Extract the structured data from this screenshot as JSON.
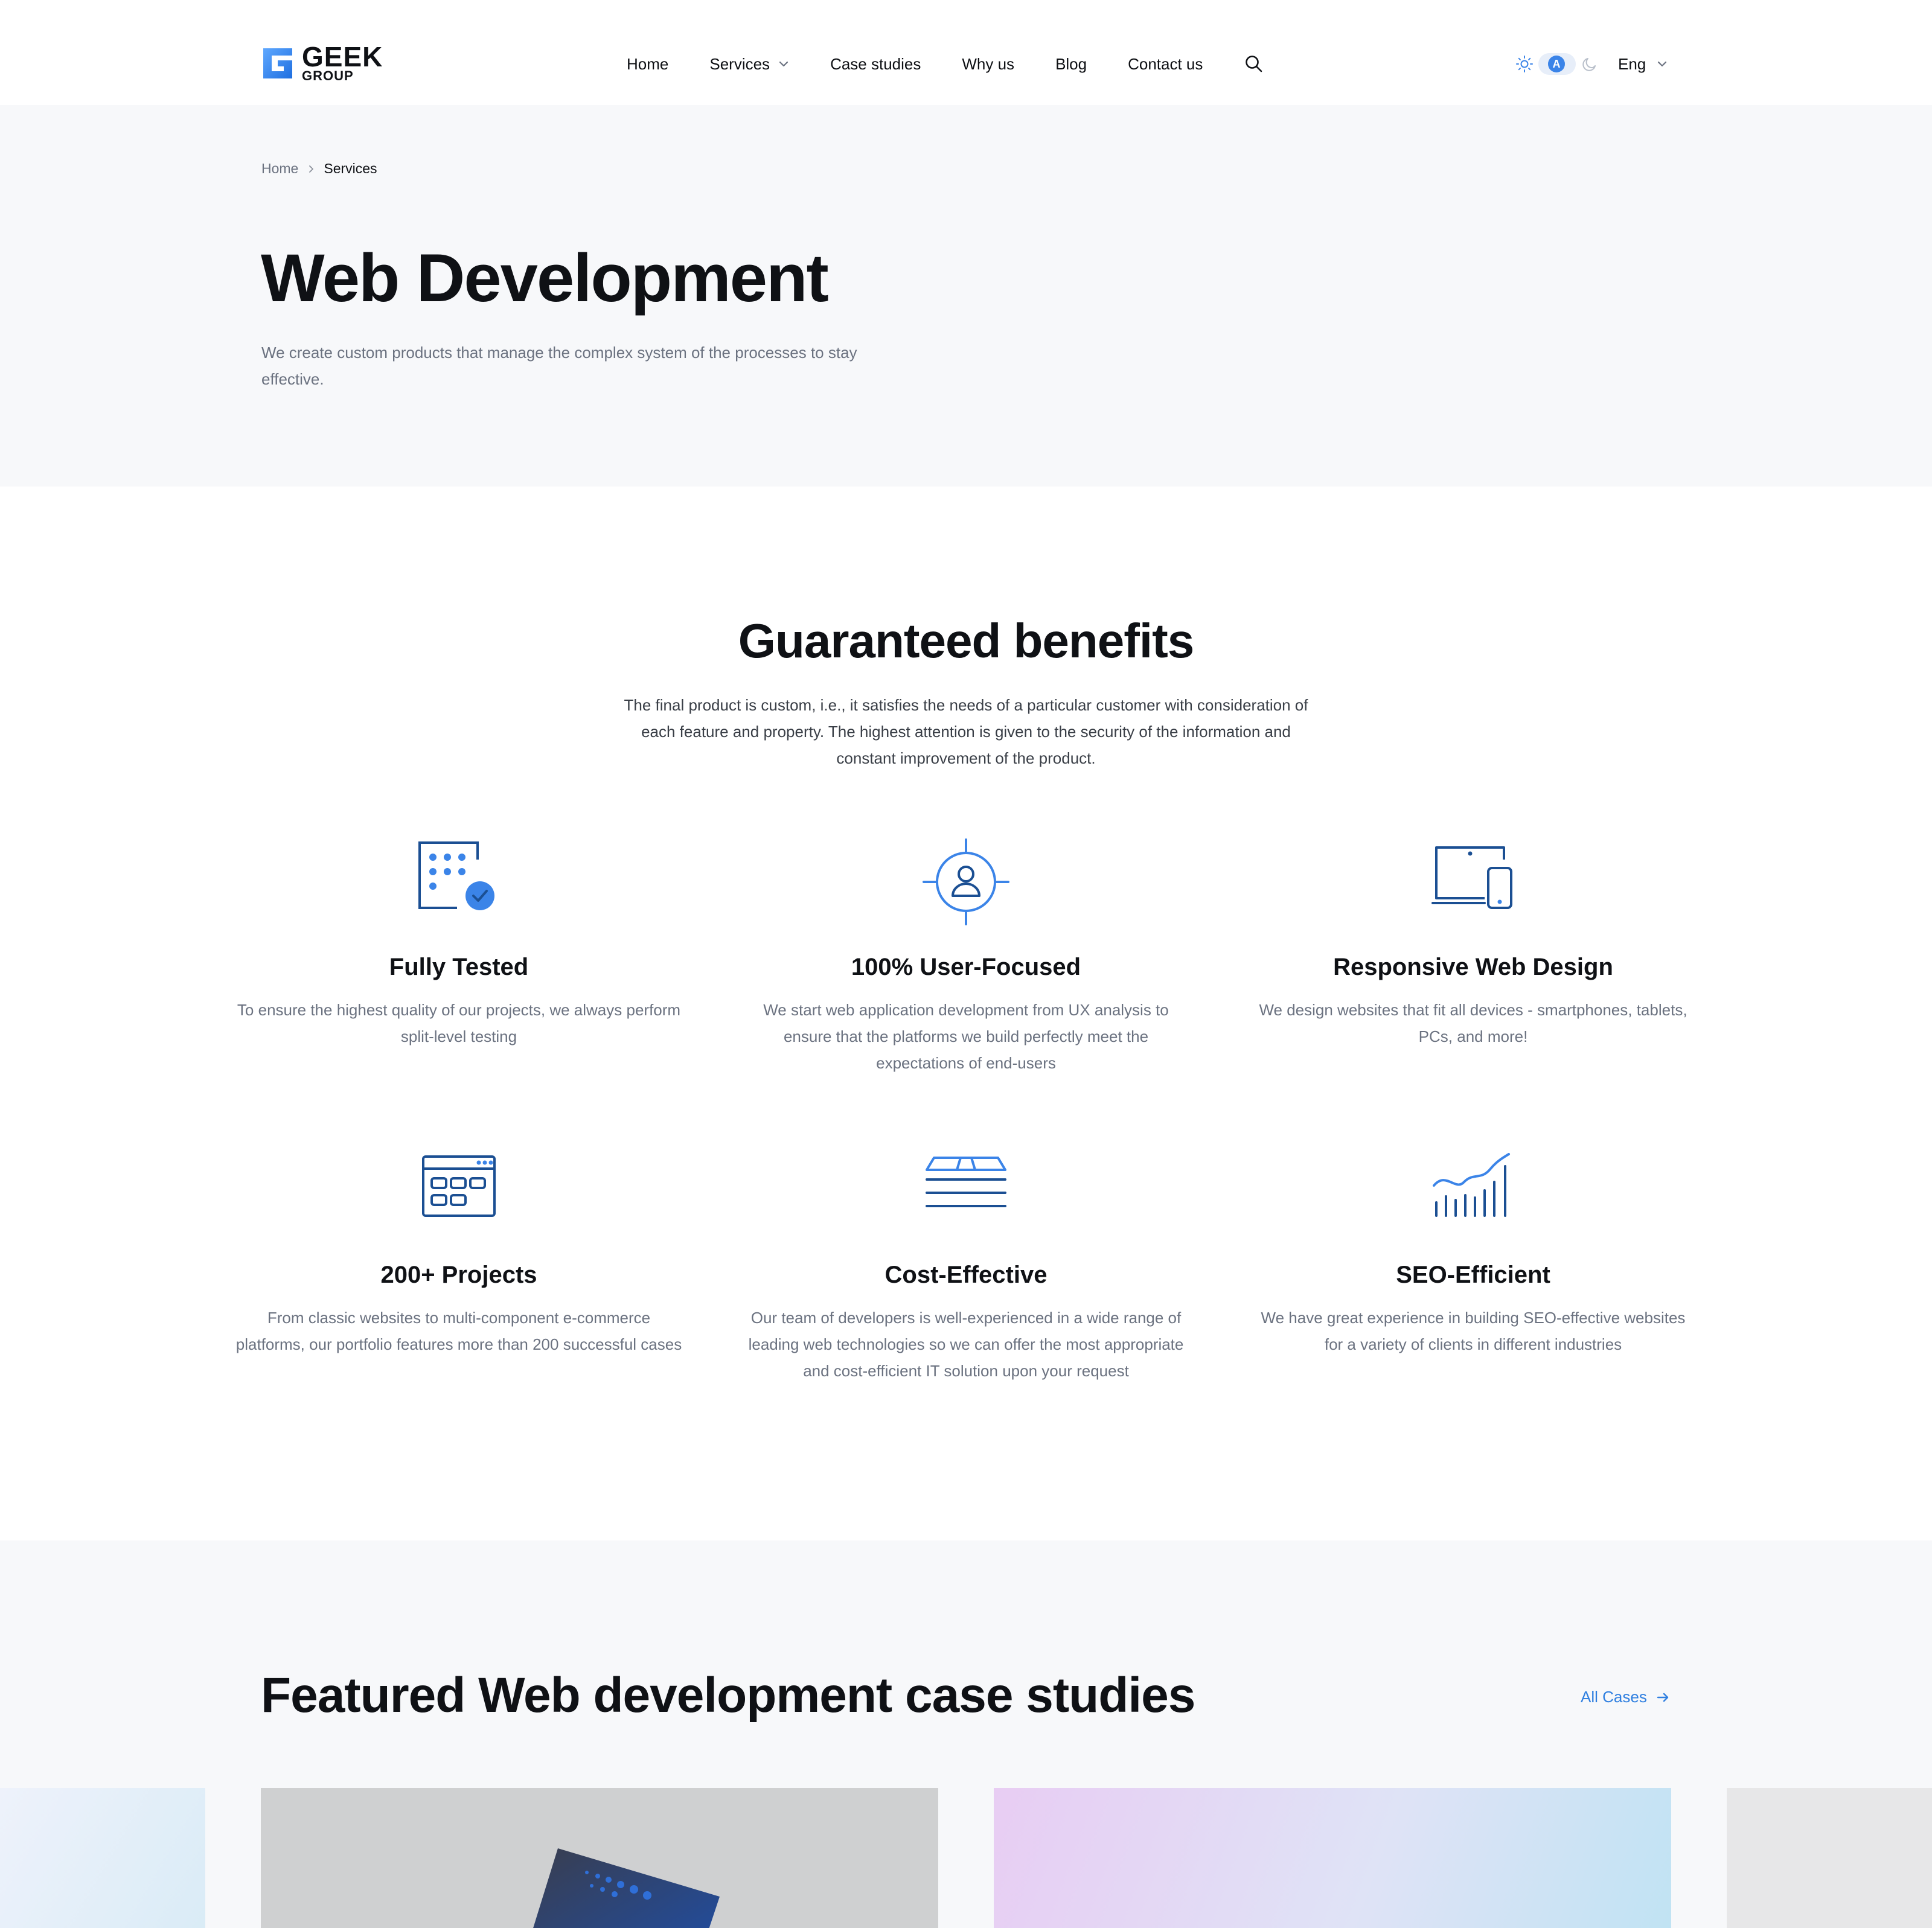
{
  "header": {
    "logo": {
      "word": "GEEK",
      "sub": "GROUP"
    },
    "nav": [
      {
        "label": "Home"
      },
      {
        "label": "Services",
        "has_dropdown": true
      },
      {
        "label": "Case studies"
      },
      {
        "label": "Why us"
      },
      {
        "label": "Blog"
      },
      {
        "label": "Contact us"
      }
    ],
    "theme_toggle": {
      "selected": "A"
    },
    "language": "Eng"
  },
  "hero": {
    "breadcrumb": {
      "home": "Home",
      "current": "Services"
    },
    "title": "Web Development",
    "subtitle": "We create custom products that manage the complex system of the processes to stay effective."
  },
  "benefits": {
    "title": "Guaranteed benefits",
    "subtitle": "The final product is custom, i.e., it satisfies the needs of a particular customer with consideration of each feature and property. The highest attention is given to the security of the information and constant improvement of the product.",
    "cards": [
      {
        "icon": "calendar-check-icon",
        "title": "Fully Tested",
        "text": "To ensure the highest quality of our projects, we always perform split-level testing"
      },
      {
        "icon": "user-target-icon",
        "title": "100% User-Focused",
        "text": "We start web application development from UX analysis to ensure that the platforms we build perfectly meet the expectations of end-users"
      },
      {
        "icon": "devices-icon",
        "title": "Responsive Web Design",
        "text": "We design websites that fit all devices - smartphones, tablets, PCs, and more!"
      },
      {
        "icon": "browser-grid-icon",
        "title": "200+ Projects",
        "text": "From classic websites to multi-component e-commerce platforms, our portfolio features more than 200 successful cases"
      },
      {
        "icon": "stacked-layers-icon",
        "title": "Cost-Effective",
        "text": "Our team of developers is well-experienced in a wide range of leading web technologies so we can offer the most appropriate and cost-efficient IT solution upon your request"
      },
      {
        "icon": "growth-chart-icon",
        "title": "SEO-Efficient",
        "text": "We have great experience in building SEO-effective websites for a variety of clients in different industries"
      }
    ]
  },
  "cases": {
    "title": "Featured Web development case studies",
    "all_cases": "All Cases"
  },
  "colors": {
    "accent": "#2f7fe0",
    "icon_dark": "#1b4f93",
    "text_primary": "#0f1115",
    "text_muted": "#6b7280",
    "bg_light": "#f7f8fa"
  }
}
